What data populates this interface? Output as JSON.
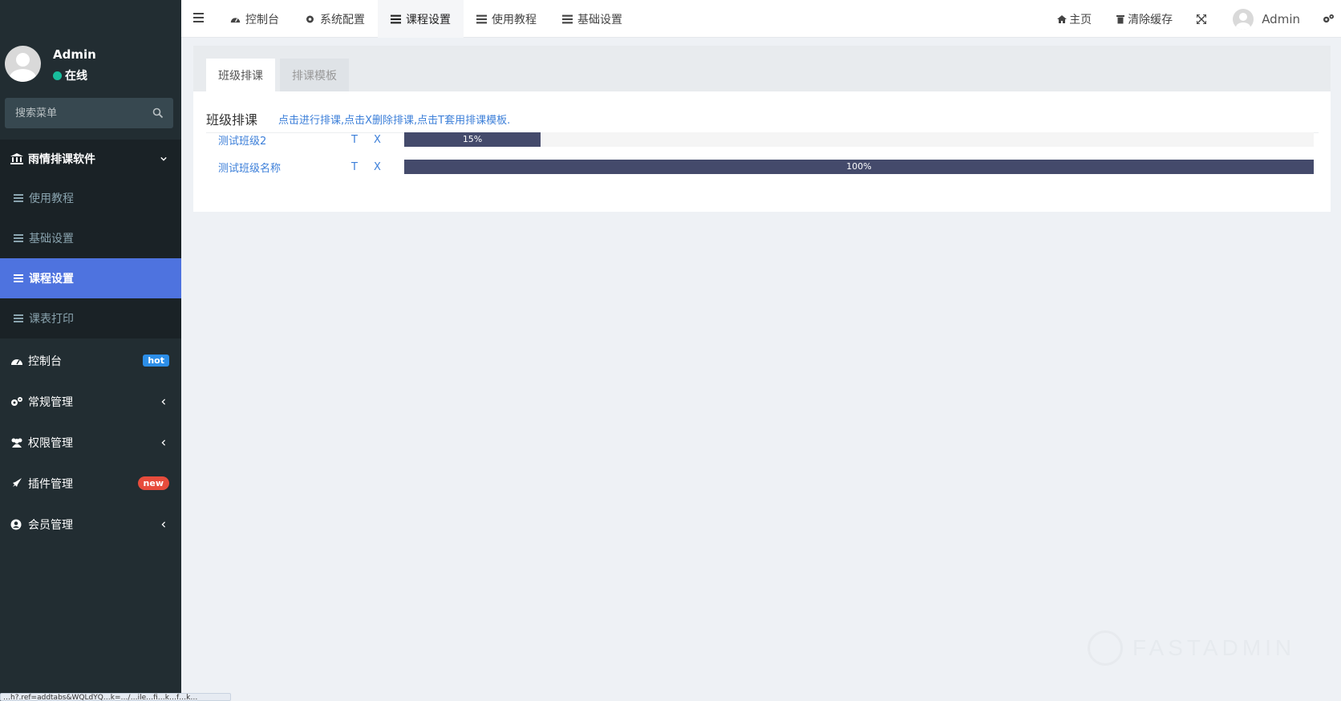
{
  "sidebar": {
    "user_name": "Admin",
    "user_status": "在线",
    "search_placeholder": "搜索菜单",
    "group_title": "雨情排课软件",
    "sub_items": [
      "使用教程",
      "基础设置",
      "课程设置",
      "课表打印"
    ],
    "menu_items": [
      {
        "label": "控制台",
        "badge": "hot"
      },
      {
        "label": "常规管理"
      },
      {
        "label": "权限管理"
      },
      {
        "label": "插件管理",
        "badge": "new"
      },
      {
        "label": "会员管理"
      }
    ],
    "status_url": "…h?.ref=addtabs&WQLdYQ…k=…/…ile…fi…k…f…k…"
  },
  "topbar": {
    "tabs": [
      "控制台",
      "系统配置",
      "课程设置",
      "使用教程",
      "基础设置"
    ],
    "home": "主页",
    "clear_cache": "清除缓存",
    "admin": "Admin"
  },
  "panel": {
    "tabs": [
      "班级排课",
      "排课模板"
    ],
    "title": "班级排课",
    "hint": "点击进行排课,点击X删除排课,点击T套用排课模板.",
    "rows": [
      {
        "name": "测试班级2",
        "t": "T",
        "x": "X",
        "progress": 15,
        "progress_label": "15%"
      },
      {
        "name": "测试班级名称",
        "t": "T",
        "x": "X",
        "progress": 100,
        "progress_label": "100%"
      }
    ]
  },
  "watermark": "FASTADMIN",
  "colors": {
    "sidebar_bg": "#222d32",
    "accent": "#4e73df",
    "link": "#3c7fd9",
    "progress": "#444a6b",
    "online": "#18bc9c",
    "hot": "#2c8ee8",
    "new": "#e74c3c"
  }
}
